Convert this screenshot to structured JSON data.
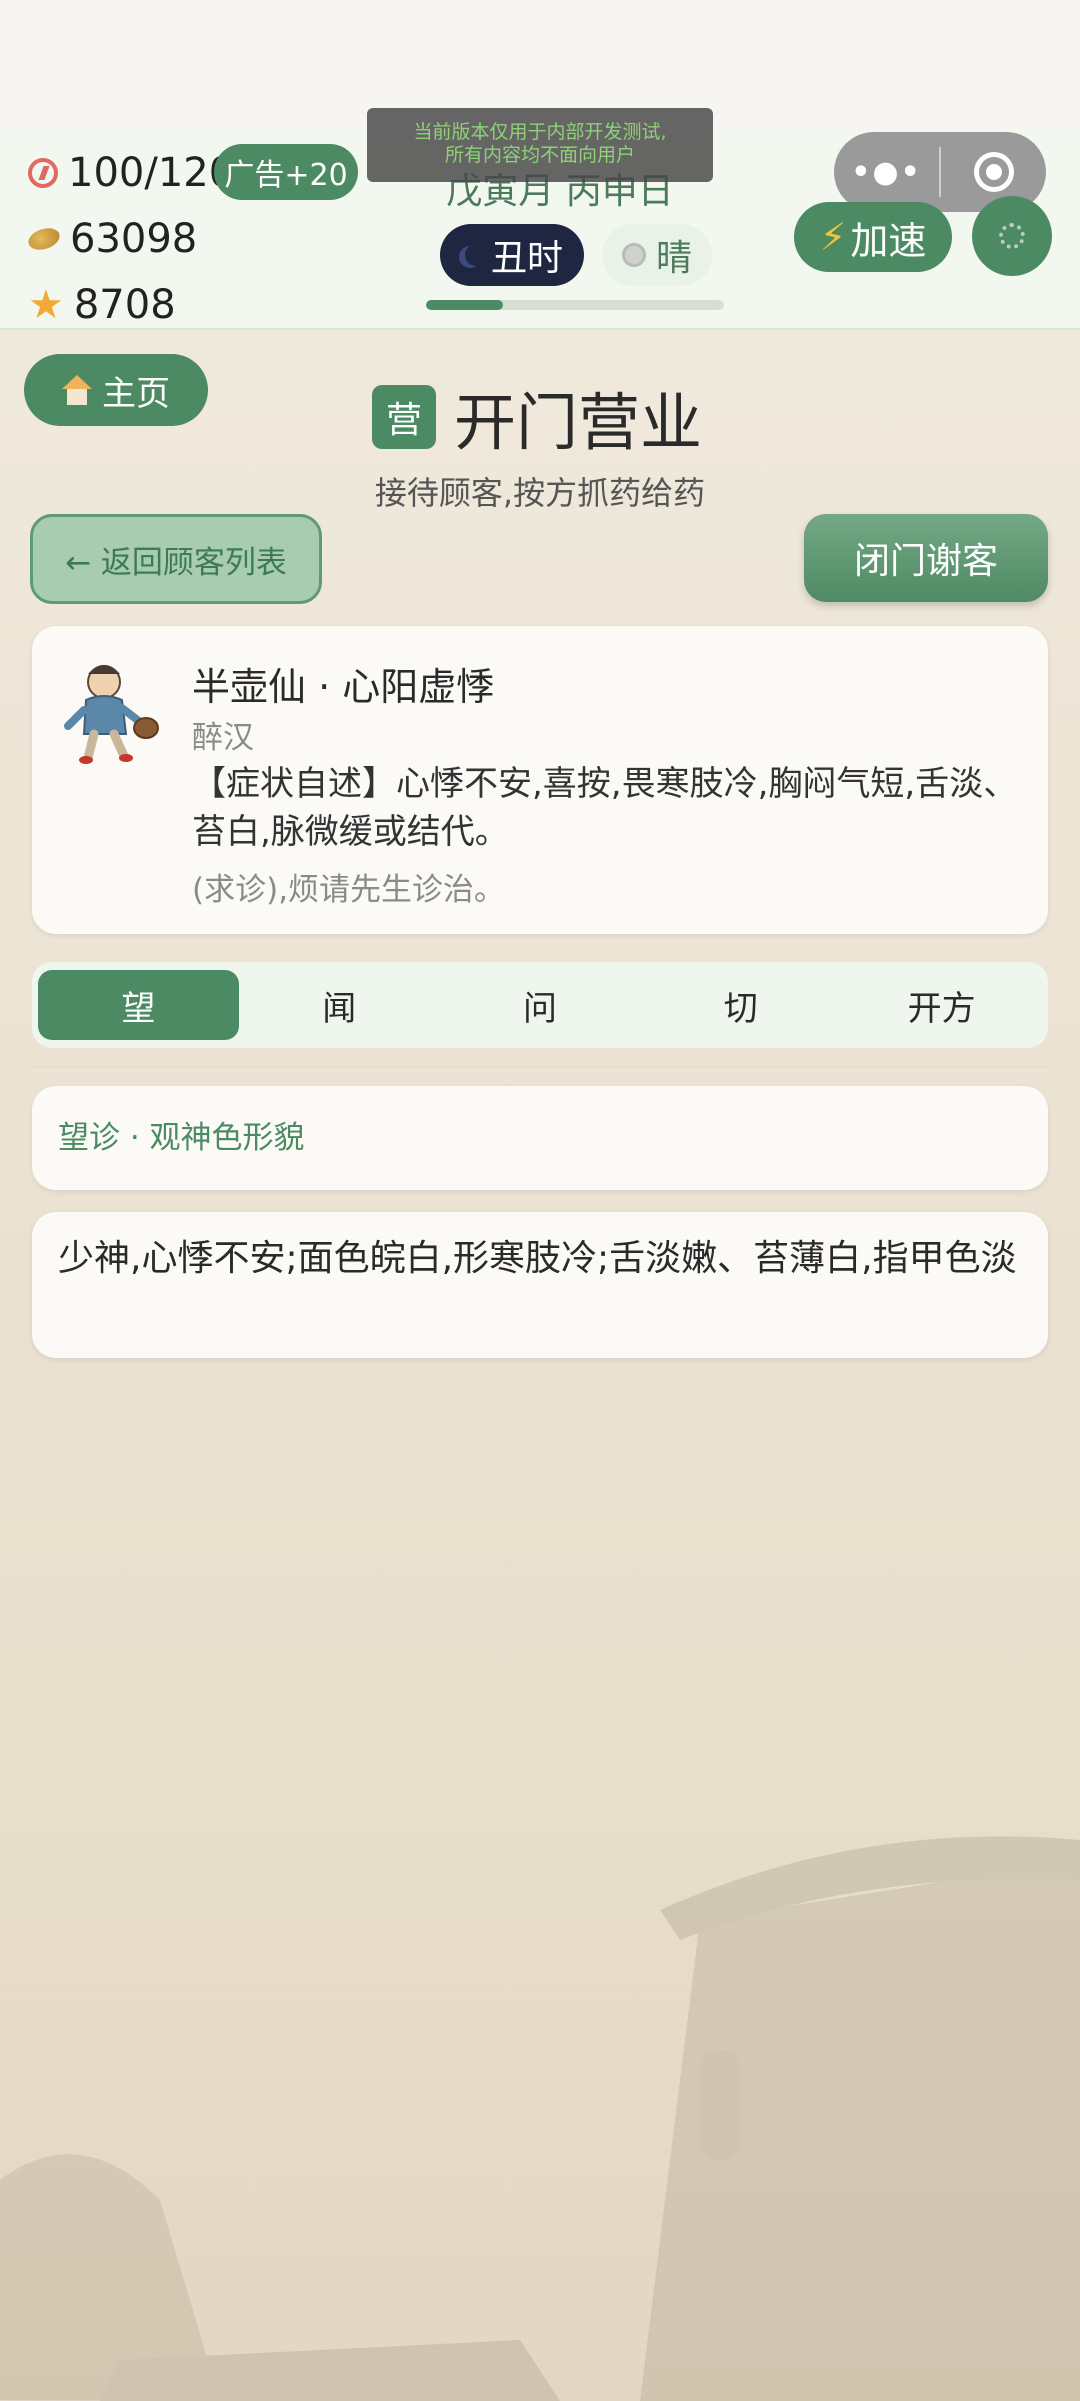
{
  "status": {
    "energy": "100/120",
    "ad_button": "广告+20",
    "coins": "63098",
    "stars": "8708",
    "notice_line1": "当前版本仅用于内部开发测试,",
    "notice_line2": "所有内容均不面向用户",
    "date": "戊寅月 丙申日",
    "time": "丑时",
    "weather": "晴",
    "day_progress": 0.26,
    "speed_button": "加速"
  },
  "icons": {
    "energy": "energy-icon",
    "coin": "coin-icon",
    "star": "star-icon",
    "moon": "moon-icon",
    "weather": "sun-icon",
    "menu": "more-dots-icon",
    "close_app": "target-icon",
    "bolt": "bolt-icon",
    "settings": "gear-icon",
    "home": "house-icon"
  },
  "nav": {
    "home": "主页",
    "back": "← 返回顾客列表",
    "close_shop": "闭门谢客"
  },
  "page": {
    "badge": "营",
    "title": "开门营业",
    "subtitle": "接待顾客,按方抓药给药"
  },
  "patient": {
    "name": "半壶仙 · 心阳虚悸",
    "role": "醉汉",
    "description": "【症状自述】心悸不安,喜按,畏寒肢冷,胸闷气短,舌淡、苔白,脉微缓或结代。",
    "request": "(求诊),烦请先生诊治。"
  },
  "tabs": [
    "望",
    "闻",
    "问",
    "切",
    "开方"
  ],
  "active_tab": 0,
  "section": {
    "label": "望诊 · 观神色形貌",
    "content": "少神,心悸不安;面色皖白,形寒肢冷;舌淡嫩、苔薄白,指甲色淡"
  },
  "colors": {
    "primary": "#4c8a63",
    "night_pill": "#1e2642",
    "accent_gold": "#f3a93a",
    "background": "#ece4d4"
  }
}
